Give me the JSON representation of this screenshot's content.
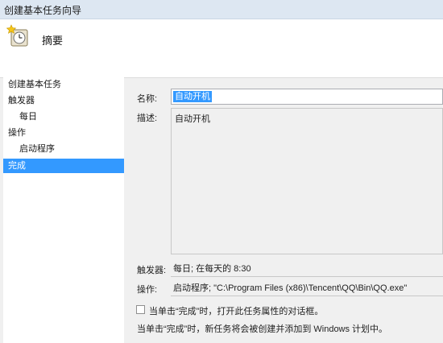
{
  "window": {
    "title": "创建基本任务向导"
  },
  "header": {
    "title": "摘要",
    "icon": "clock-task-icon"
  },
  "steps": [
    {
      "label": "创建基本任务",
      "active": false
    },
    {
      "label": "触发器",
      "active": false
    },
    {
      "label": "每日",
      "active": false
    },
    {
      "label": "操作",
      "active": false
    },
    {
      "label": "启动程序",
      "active": false
    },
    {
      "label": "完成",
      "active": true
    }
  ],
  "summary": {
    "name_label": "名称:",
    "name_value": "自动开机",
    "description_label": "描述:",
    "description_value": "自动开机",
    "trigger_label": "触发器:",
    "trigger_value": "每日; 在每天的 8:30",
    "action_label": "操作:",
    "action_value": "启动程序; \"C:\\Program Files (x86)\\Tencent\\QQ\\Bin\\QQ.exe\""
  },
  "options": {
    "open_properties_label": "当单击“完成”时，打开此任务属性的对话框。",
    "open_properties_checked": false,
    "finish_note": "当单击“完成”时，新任务将会被创建并添加到 Windows 计划中。"
  },
  "colors": {
    "selection": "#3399ff",
    "titlebar": "#dde7f2"
  }
}
